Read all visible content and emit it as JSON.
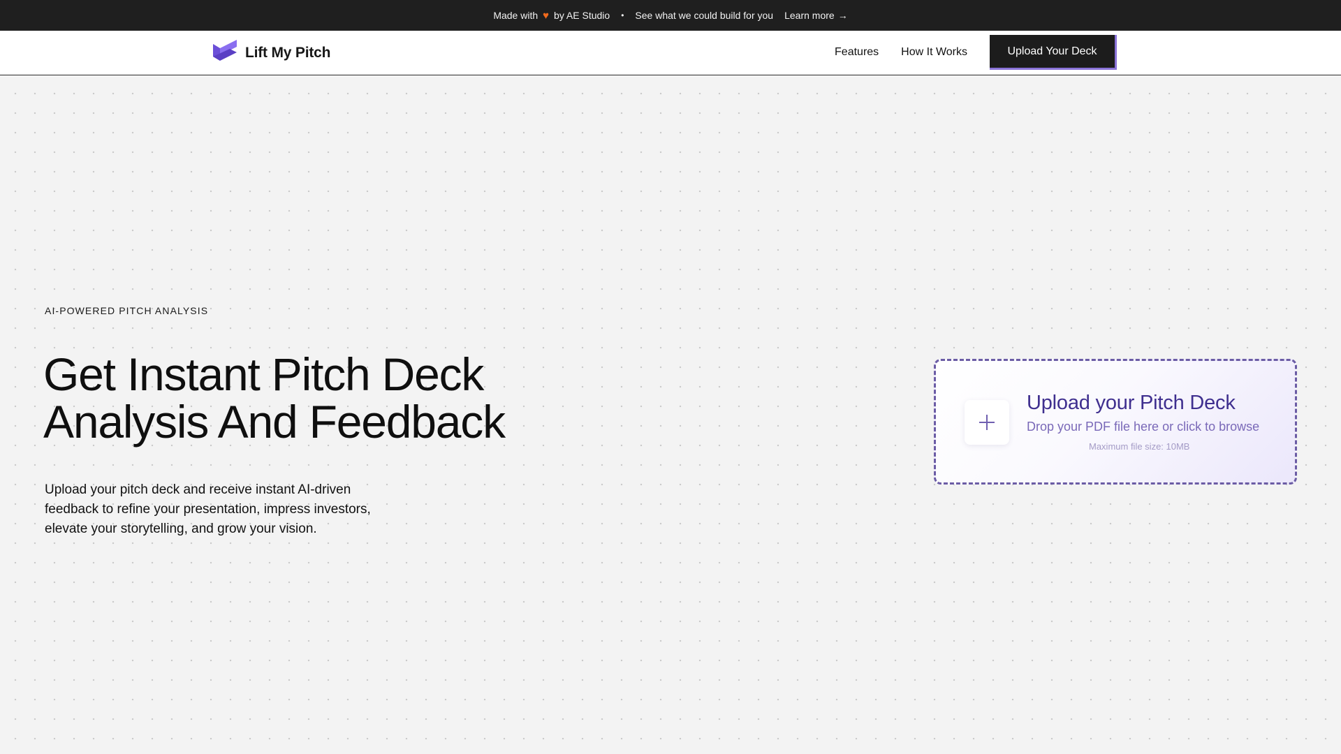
{
  "topbar": {
    "made_with": "Made with",
    "heart_icon": "heart-icon",
    "by_studio": "by AE Studio",
    "separator": "•",
    "pitch": "See what we could build for you",
    "learn_more": "Learn more",
    "arrow": "→"
  },
  "nav": {
    "brand": "Lift My Pitch",
    "logo_icon": "lift-my-pitch-logo",
    "links": [
      "Features",
      "How It Works"
    ],
    "cta": "Upload Your Deck"
  },
  "hero": {
    "eyebrow": "AI-POWERED PITCH ANALYSIS",
    "headline_line1": "Get Instant Pitch Deck",
    "headline_line2": "Analysis And Feedback",
    "subtext_line1": "Upload your pitch deck and receive instant AI-driven",
    "subtext_line2": "feedback to refine your presentation, impress investors,",
    "subtext_line3": "elevate your storytelling, and grow your vision."
  },
  "upload": {
    "title": "Upload your Pitch Deck",
    "description": "Drop your PDF file here or click to browse",
    "limit": "Maximum file size: 10MB",
    "icon": "plus-icon"
  },
  "colors": {
    "topbar_bg": "#1f1f1f",
    "accent_purple": "#8a73d8",
    "heart_orange": "#f06a1d",
    "upload_title": "#3f2f8f",
    "page_bg": "#f3f3f3"
  }
}
